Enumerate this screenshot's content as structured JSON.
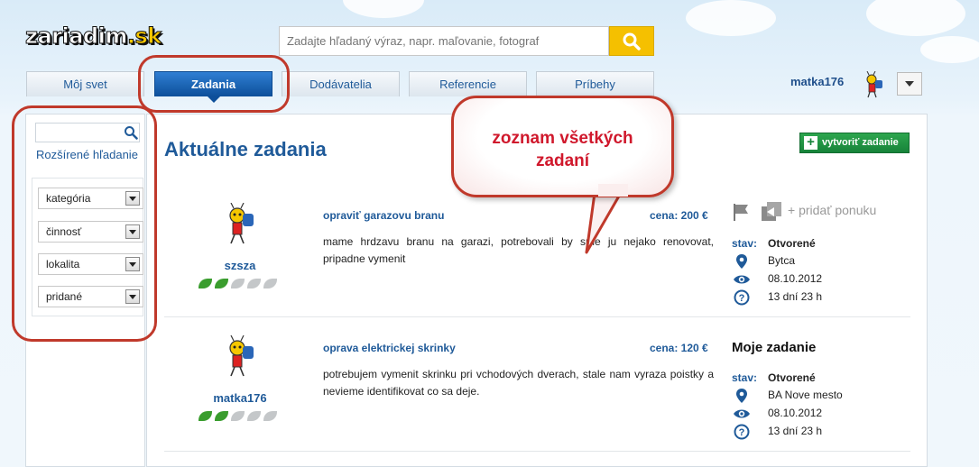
{
  "header": {
    "logo_main": "zariadim",
    "logo_tld": ".sk",
    "search_placeholder": "Zadajte hľadaný výraz, napr. maľovanie, fotograf",
    "username": "matka176"
  },
  "tabs": [
    {
      "label": "Môj svet"
    },
    {
      "label": "Zadania",
      "active": true
    },
    {
      "label": "Dodávatelia"
    },
    {
      "label": "Referencie"
    },
    {
      "label": "Príbehy"
    }
  ],
  "sidebar": {
    "advanced_search": "Rozšírené hľadanie",
    "filters": [
      {
        "label": "kategória"
      },
      {
        "label": "činnosť"
      },
      {
        "label": "lokalita"
      },
      {
        "label": "pridané"
      }
    ]
  },
  "main": {
    "title": "Aktuálne zadania",
    "create_button": "vytvoriť zadanie",
    "add_offer": "+ pridať ponuku",
    "my_task_label": "Moje zadanie",
    "tasks": [
      {
        "user": "szsza",
        "rating": 2,
        "title": "opraviť garazovu branu",
        "price": "cena: 200 €",
        "description": "mame hrdzavu branu na garazi, potrebovali by sme ju nejako renovovat, pripadne vymenit",
        "status_label": "stav:",
        "status": "Otvorené",
        "location": "Bytca",
        "date": "08.10.2012",
        "remaining": "13 dní 23 h"
      },
      {
        "user": "matka176",
        "rating": 2,
        "title": "oprava elektrickej skrinky",
        "price": "cena: 120 €",
        "description": "potrebujem vymenit skrinku pri vchodových dverach, stale nam vyraza poistky a nevieme identifikovat co sa deje.",
        "status_label": "stav:",
        "status": "Otvorené",
        "location": "BA Nove mesto",
        "date": "08.10.2012",
        "remaining": "13 dní 23 h"
      }
    ]
  },
  "callout": {
    "line1": "zoznam všetkých",
    "line2": "zadaní"
  },
  "colors": {
    "brand_blue": "#1f5a99",
    "active_tab": "#0d4f9a",
    "search_button": "#f5c000",
    "create_green": "#17833a",
    "annotation_red": "#c0392b"
  }
}
